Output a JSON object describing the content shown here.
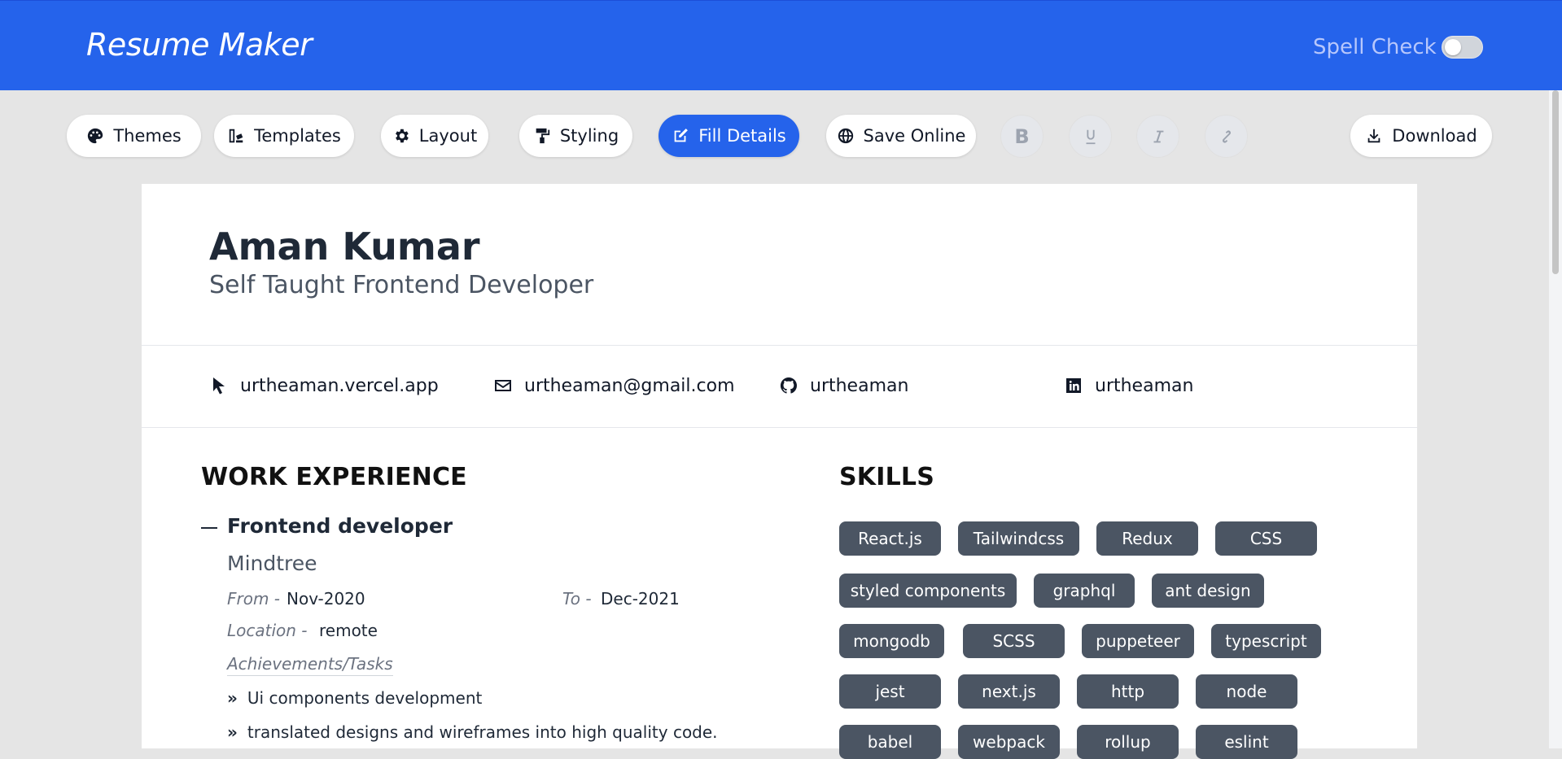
{
  "app": {
    "title": "Resume Maker"
  },
  "header": {
    "spell_check_label": "Spell Check",
    "spell_check_on": false
  },
  "toolbar": {
    "themes": "Themes",
    "templates": "Templates",
    "layout": "Layout",
    "styling": "Styling",
    "fill_details": "Fill Details",
    "save_online": "Save Online",
    "download": "Download",
    "bold_glyph": "B"
  },
  "resume": {
    "name": "Aman Kumar",
    "role": "Self Taught Frontend Developer",
    "contacts": {
      "website": "urtheaman.vercel.app",
      "email": "urtheaman@gmail.com",
      "github": "urtheaman",
      "linkedin": "urtheaman"
    },
    "work": {
      "heading": "WORK EXPERIENCE",
      "jobs": [
        {
          "title": "Frontend developer",
          "company": "Mindtree",
          "from_label": "From -",
          "from": "Nov-2020",
          "to_label": "To -",
          "to": "Dec-2021",
          "location_label": "Location -",
          "location": "remote",
          "achievements_label": "Achievements/Tasks",
          "tasks": [
            "Ui components development",
            "translated designs and wireframes into high quality code."
          ]
        }
      ]
    },
    "skills": {
      "heading": "SKILLS",
      "items": [
        "React.js",
        "Tailwindcss",
        "Redux",
        "CSS",
        "styled components",
        "graphql",
        "ant design",
        "mongodb",
        "SCSS",
        "puppeteer",
        "typescript",
        "jest",
        "next.js",
        "http",
        "node",
        "babel",
        "webpack",
        "rollup",
        "eslint"
      ]
    }
  },
  "colors": {
    "accent": "#2563eb",
    "chip": "#4b5563",
    "page_bg": "#e5e5e5"
  }
}
